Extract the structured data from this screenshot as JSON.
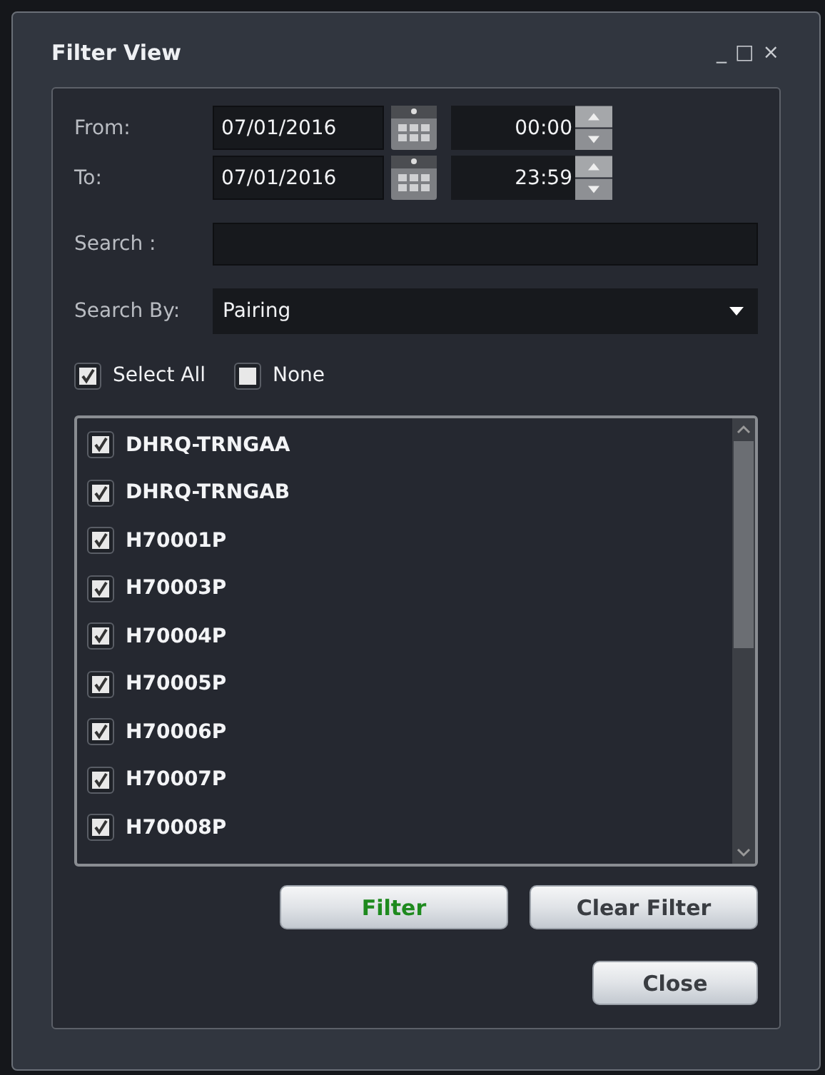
{
  "window": {
    "title": "Filter View",
    "controls": [
      "_",
      "□",
      "×"
    ]
  },
  "from": {
    "label": "From:",
    "date": "07/01/2016",
    "time": "00:00"
  },
  "to": {
    "label": "To:",
    "date": "07/01/2016",
    "time": "23:59"
  },
  "search": {
    "label": "Search :"
  },
  "search_by": {
    "label": "Search By:",
    "value": "Pairing"
  },
  "select_all": {
    "label": "Select All",
    "checked": true
  },
  "none": {
    "label": "None",
    "checked": false
  },
  "items": [
    {
      "label": "DHRQ-TRNGAA",
      "checked": true
    },
    {
      "label": "DHRQ-TRNGAB",
      "checked": true
    },
    {
      "label": "H70001P",
      "checked": true
    },
    {
      "label": "H70003P",
      "checked": true
    },
    {
      "label": "H70004P",
      "checked": true
    },
    {
      "label": "H70005P",
      "checked": true
    },
    {
      "label": "H70006P",
      "checked": true
    },
    {
      "label": "H70007P",
      "checked": true
    },
    {
      "label": "H70008P",
      "checked": true
    }
  ],
  "buttons": [
    {
      "label": "Filter",
      "kind": "primary"
    },
    {
      "label": "Clear Filter",
      "kind": "normal"
    },
    {
      "label": "Close",
      "kind": "normal"
    }
  ]
}
